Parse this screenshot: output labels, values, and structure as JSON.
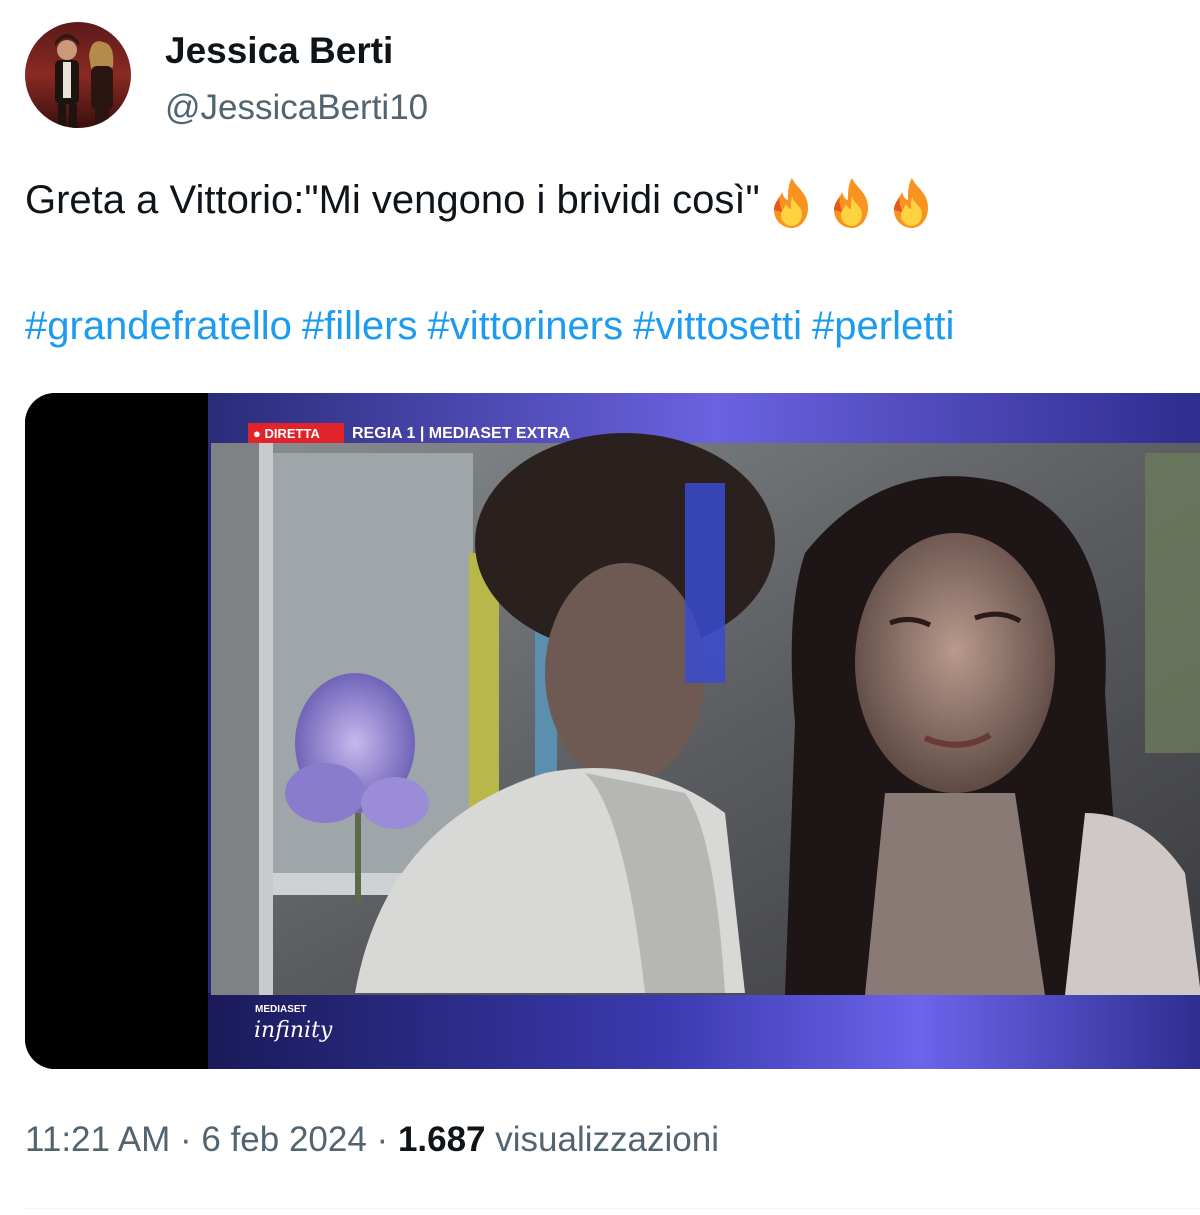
{
  "author": {
    "display_name": "Jessica Berti",
    "handle": "@JessicaBerti10"
  },
  "tweet": {
    "text": "Greta a Vittorio:\"Mi vengono i brividi così\"",
    "emojis": [
      "fire-icon",
      "fire-icon",
      "fire-icon"
    ],
    "hashtags": [
      "#grandefratello",
      "#fillers",
      "#vittoriners",
      "#vittosetti",
      "#perletti"
    ]
  },
  "media": {
    "live_badge": "● DIRETTA",
    "channel_label": "REGIA 1 | MEDIASET EXTRA",
    "brand_top": "MEDIASET",
    "brand_bottom": "infinity"
  },
  "meta": {
    "time": "11:21 AM",
    "separator": " · ",
    "date": "6 feb 2024",
    "views_count": "1.687",
    "views_label": "visualizzazioni"
  },
  "colors": {
    "link": "#1d9bf0",
    "secondary_text": "#536471",
    "live_red": "#e0242a",
    "frame_purple": "#3c3aa6"
  }
}
